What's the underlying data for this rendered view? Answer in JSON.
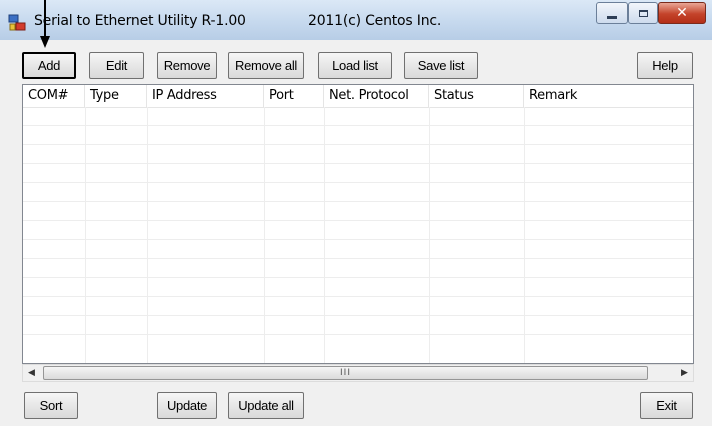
{
  "window": {
    "title": "Serial to Ethernet Utility   R-1.00",
    "copyright": "2011(c)  Centos Inc."
  },
  "toolbar": {
    "add": "Add",
    "edit": "Edit",
    "remove": "Remove",
    "remove_all": "Remove all",
    "load_list": "Load list",
    "save_list": "Save list",
    "help": "Help"
  },
  "table": {
    "columns": [
      "COM#",
      "Type",
      "IP Address",
      "Port",
      "Net. Protocol",
      "Status",
      "Remark"
    ],
    "rows": []
  },
  "scrollbar": {
    "thumb_grip": "III"
  },
  "footer": {
    "sort": "Sort",
    "update": "Update",
    "update_all": "Update all",
    "exit": "Exit"
  },
  "icons": {
    "app": "network-computer-icon",
    "minimize": "minimize-icon",
    "maximize": "maximize-icon",
    "close": "close-icon",
    "annotation": "down-arrow-icon"
  },
  "colors": {
    "titlebar": "#c6d9ee",
    "close_button": "#c4432a",
    "window_bg": "#f0f0f0",
    "grid_line": "#ededed"
  }
}
